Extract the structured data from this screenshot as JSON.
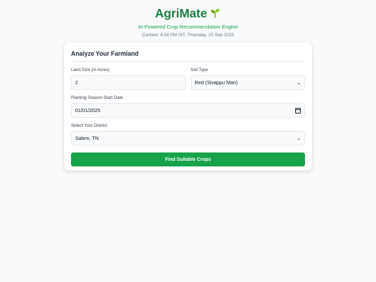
{
  "header": {
    "title": "AgriMate",
    "subtitle": "AI-Powered Crop Recommendation Engine",
    "context": "Context: 4:34 PM IST, Thursday, 25 Sep 2025"
  },
  "form": {
    "title": "Analyze Your Farmland",
    "land_size": {
      "label": "Land Size (in Acres)",
      "value": "2"
    },
    "soil_type": {
      "label": "Soil Type",
      "value": "Red (Sivappu Man)"
    },
    "season_date": {
      "label": "Planting Season Start Date",
      "value": "01/01/2025"
    },
    "district": {
      "label": "Select Your District",
      "value": "Salem, TN"
    },
    "submit_label": "Find Suitable Crops"
  },
  "colors": {
    "brand_green": "#15803d",
    "button_green": "#16a34a",
    "background": "#f8fafc"
  },
  "icons": {
    "title_icon": "seedling-icon",
    "select_icon": "chevron-down-icon",
    "date_icon": "calendar-icon"
  }
}
